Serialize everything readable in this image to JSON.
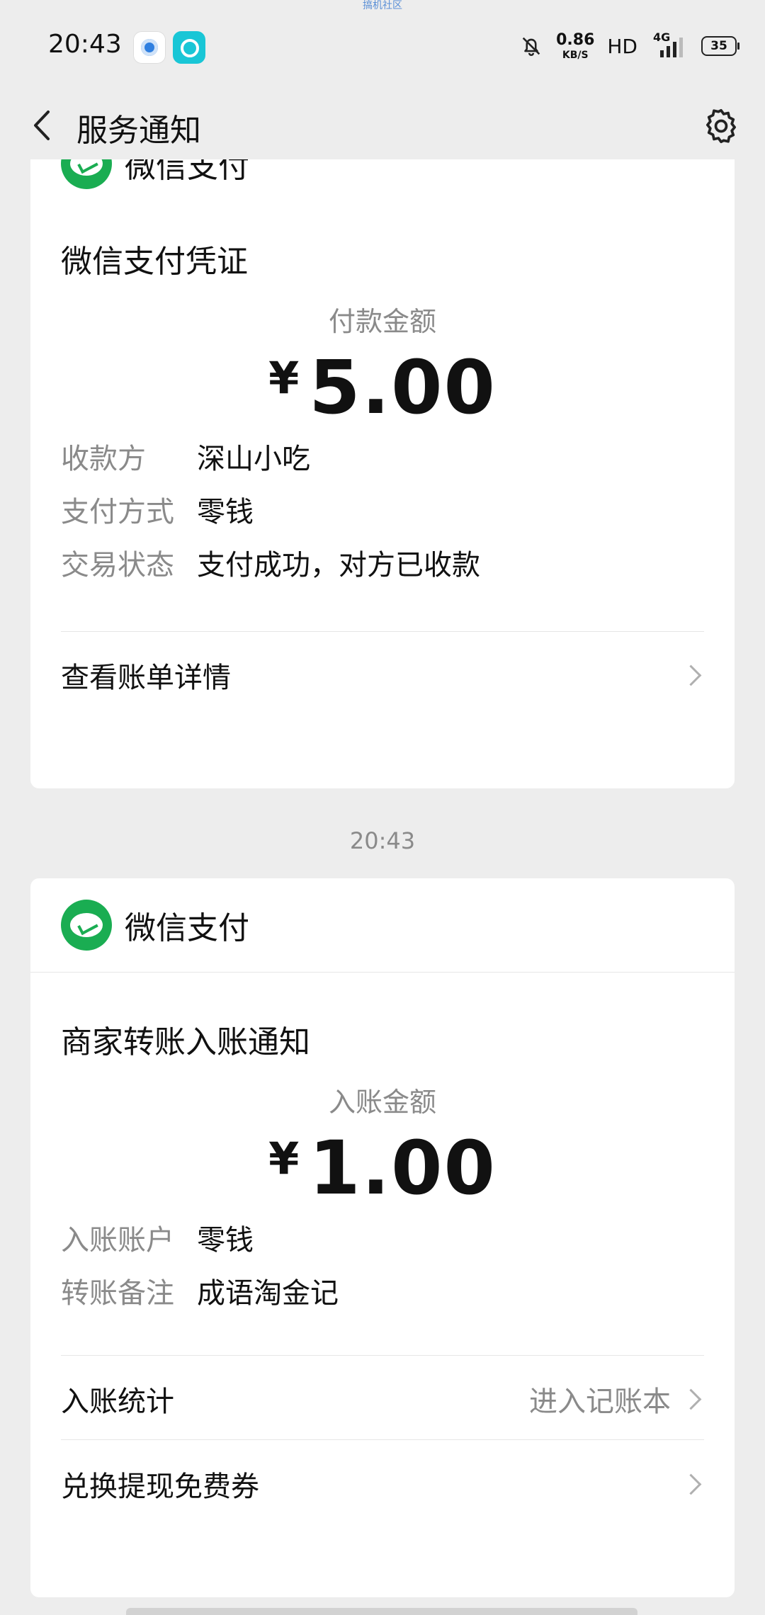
{
  "watermark": "搞机社区",
  "status_bar": {
    "time": "20:43",
    "speed_value": "0.86",
    "speed_unit": "KB/S",
    "hd": "HD",
    "network": "4G",
    "battery": "35"
  },
  "header": {
    "title": "服务通知"
  },
  "card1": {
    "title": "微信支付凭证",
    "amount_label": "付款金额",
    "currency": "¥",
    "amount": "5.00",
    "fields": [
      {
        "key": "收款方",
        "value": "深山小吃"
      },
      {
        "key": "支付方式",
        "value": "零钱"
      },
      {
        "key": "交易状态",
        "value": "支付成功，对方已收款"
      }
    ],
    "detail_link": "查看账单详情"
  },
  "timestamp": "20:43",
  "card2": {
    "brand": "微信支付",
    "title": "商家转账入账通知",
    "amount_label": "入账金额",
    "currency": "¥",
    "amount": "1.00",
    "fields": [
      {
        "key": "入账账户",
        "value": "零钱"
      },
      {
        "key": "转账备注",
        "value": "成语淘金记"
      }
    ],
    "stats_label": "入账统计",
    "stats_action": "进入记账本",
    "coupon_label": "兑换提现免费券"
  }
}
